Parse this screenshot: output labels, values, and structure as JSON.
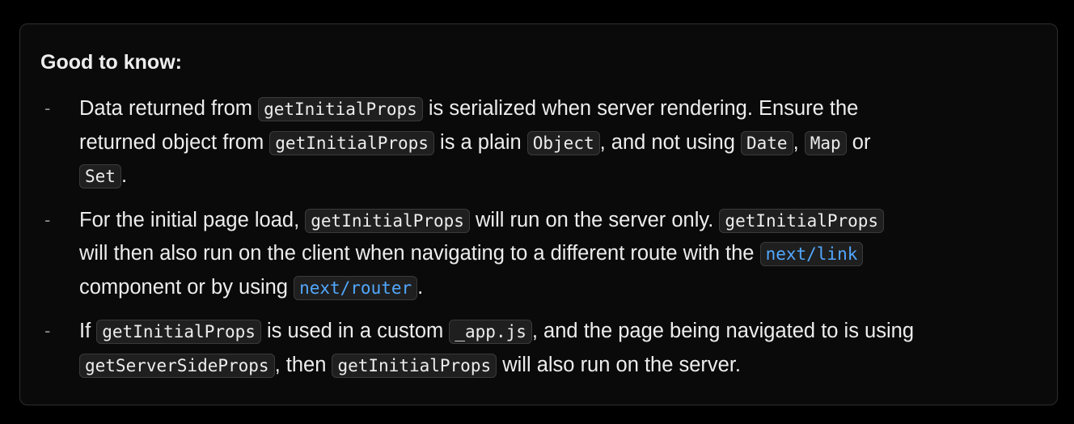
{
  "callout": {
    "title": "Good to know:",
    "bullet": "-",
    "items": [
      {
        "lines": [
          [
            {
              "t": "text",
              "v": "Data returned from "
            },
            {
              "t": "code",
              "v": "getInitialProps"
            },
            {
              "t": "text",
              "v": " is serialized when server rendering. Ensure the"
            }
          ],
          [
            {
              "t": "text",
              "v": "returned object from "
            },
            {
              "t": "code",
              "v": "getInitialProps"
            },
            {
              "t": "text",
              "v": " is a plain "
            },
            {
              "t": "code",
              "v": "Object"
            },
            {
              "t": "text",
              "v": ", and not using "
            },
            {
              "t": "code",
              "v": "Date"
            },
            {
              "t": "text",
              "v": ", "
            },
            {
              "t": "code",
              "v": "Map"
            },
            {
              "t": "text",
              "v": " or"
            }
          ],
          [
            {
              "t": "code",
              "v": "Set"
            },
            {
              "t": "text",
              "v": "."
            }
          ]
        ]
      },
      {
        "lines": [
          [
            {
              "t": "text",
              "v": "For the initial page load, "
            },
            {
              "t": "code",
              "v": "getInitialProps"
            },
            {
              "t": "text",
              "v": " will run on the server only. "
            },
            {
              "t": "code",
              "v": "getInitialProps"
            }
          ],
          [
            {
              "t": "text",
              "v": "will then also run on the client when navigating to a different route with the "
            },
            {
              "t": "link",
              "v": "next/link"
            }
          ],
          [
            {
              "t": "text",
              "v": "component or by using "
            },
            {
              "t": "link",
              "v": "next/router"
            },
            {
              "t": "text",
              "v": "."
            }
          ]
        ]
      },
      {
        "lines": [
          [
            {
              "t": "text",
              "v": "If "
            },
            {
              "t": "code",
              "v": "getInitialProps"
            },
            {
              "t": "text",
              "v": " is used in a custom "
            },
            {
              "t": "code",
              "v": "_app.js"
            },
            {
              "t": "text",
              "v": ", and the page being navigated to is using"
            }
          ],
          [
            {
              "t": "code",
              "v": "getServerSideProps"
            },
            {
              "t": "text",
              "v": ", then "
            },
            {
              "t": "code",
              "v": "getInitialProps"
            },
            {
              "t": "text",
              "v": " will also run on the server."
            }
          ]
        ]
      }
    ]
  }
}
